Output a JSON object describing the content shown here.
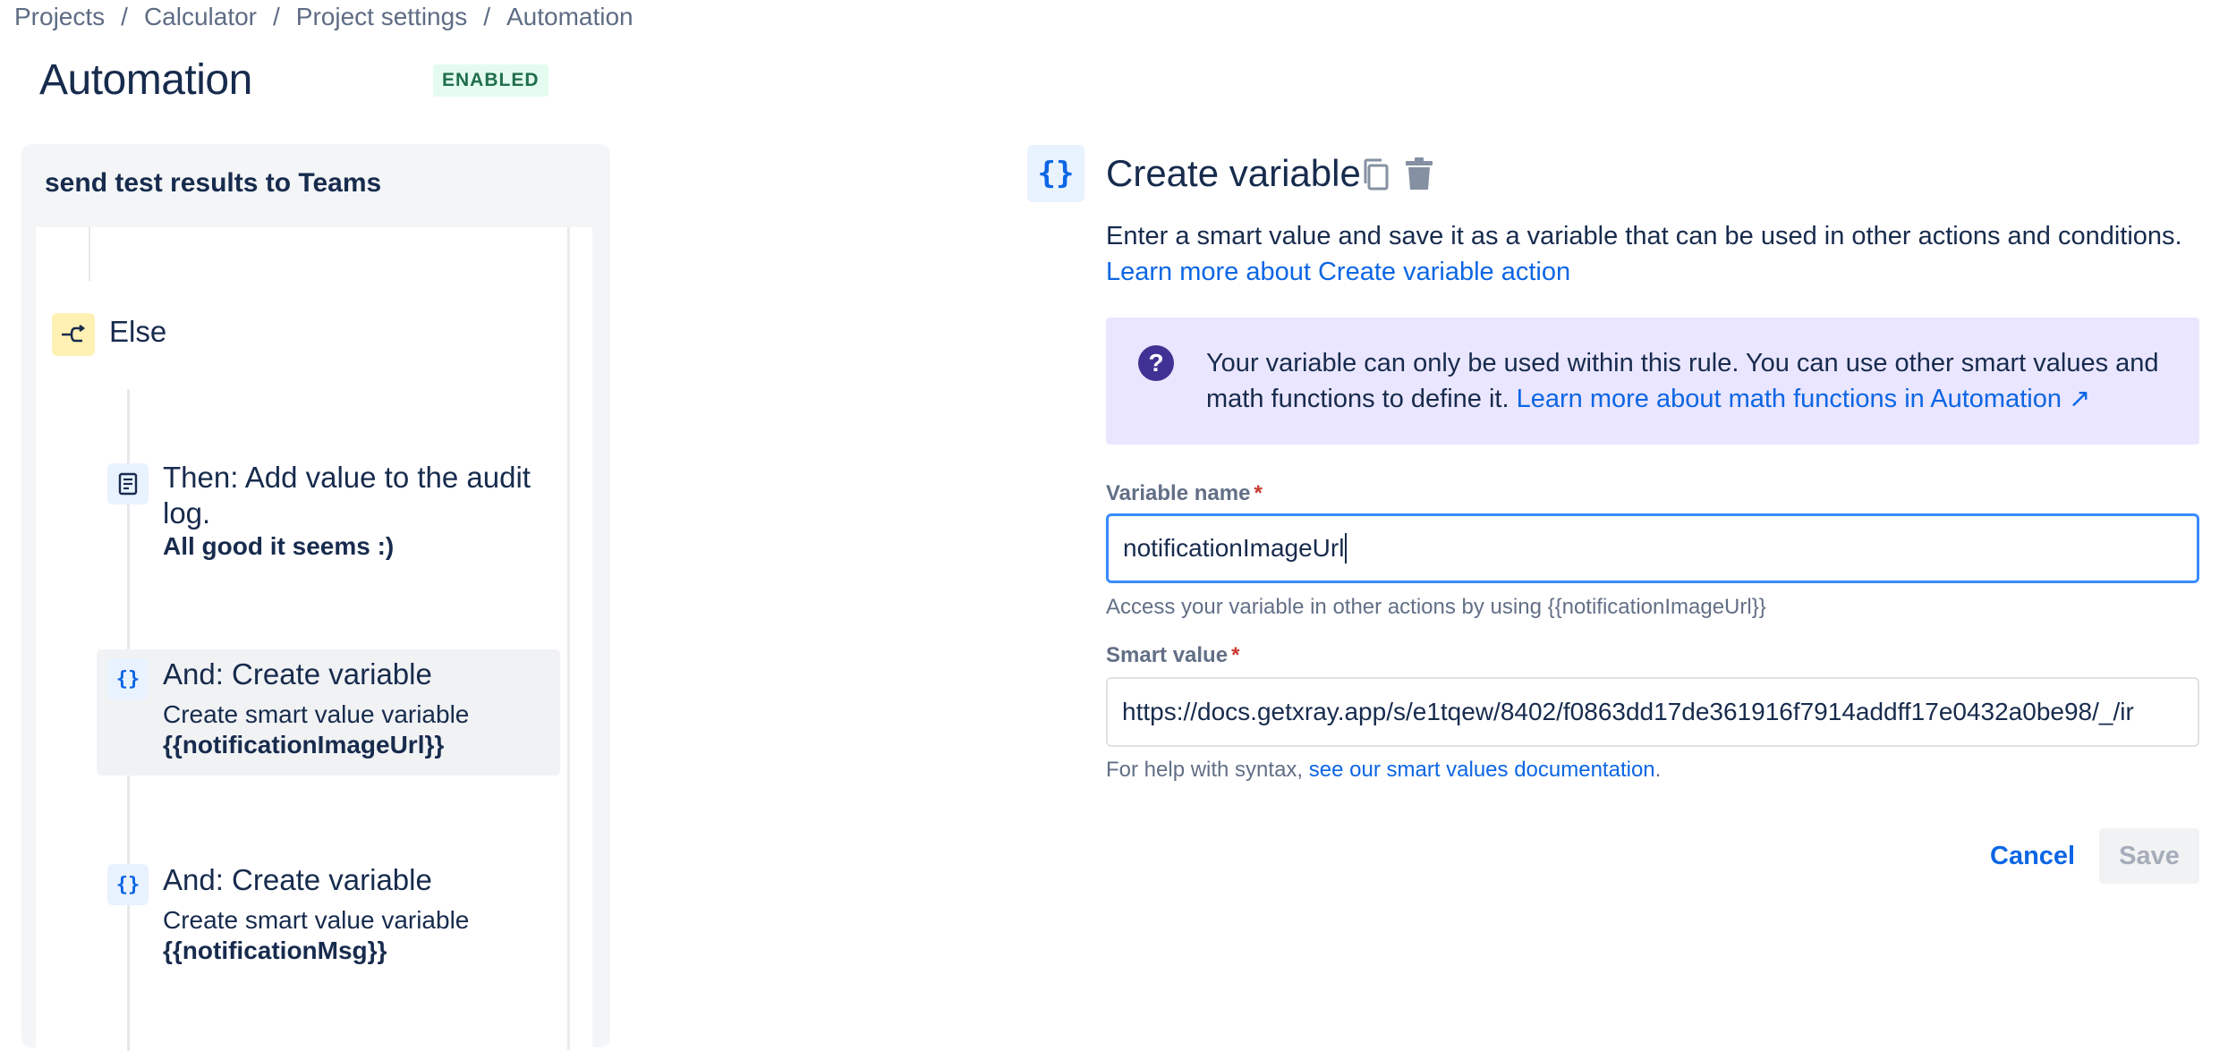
{
  "breadcrumb": [
    "Projects",
    "Calculator",
    "Project settings",
    "Automation"
  ],
  "breadcrumb_separator": "/",
  "page": {
    "title": "Automation",
    "status_badge": "ENABLED"
  },
  "rule": {
    "name": "send test results to Teams",
    "else_label": "Else",
    "components": [
      {
        "icon": "audit-log-icon",
        "title": "Then: Add value to the audit log.",
        "detail": "All good it seems :)"
      },
      {
        "icon": "braces-icon",
        "glyph": "{}",
        "title": "And: Create variable",
        "subtitle": "Create smart value variable",
        "detail": "{{notificationImageUrl}}"
      },
      {
        "icon": "braces-icon",
        "glyph": "{}",
        "title": "And: Create variable",
        "subtitle": "Create smart value variable",
        "detail": "{{notificationMsg}}"
      }
    ]
  },
  "config": {
    "icon_glyph": "{}",
    "title": "Create variable",
    "description": "Enter a smart value and save it as a variable that can be used in other actions and conditions.",
    "learn_more_link": "Learn more about Create variable action",
    "info": {
      "text": "Your variable can only be used within this rule. You can use other smart values and math functions to define it.",
      "link": "Learn more about math functions in Automation ↗",
      "icon_glyph": "?"
    },
    "variable_name": {
      "label": "Variable name",
      "required_mark": "*",
      "value": "notificationImageUrl",
      "helper": "Access your variable in other actions by using {{notificationImageUrl}}"
    },
    "smart_value": {
      "label": "Smart value",
      "required_mark": "*",
      "value": "https://docs.getxray.app/s/e1tqew/8402/f0863dd17de361916f7914addff17e0432a0be98/_/ir",
      "helper_prefix": "For help with syntax,",
      "helper_link": "see our smart values documentation",
      "helper_suffix": "."
    },
    "buttons": {
      "cancel": "Cancel",
      "save": "Save"
    }
  },
  "colors": {
    "link": "#0c66e4",
    "text": "#172b4d",
    "badge_bg": "#e3fcef",
    "badge_text": "#216e4e",
    "info_bg": "#eae6ff",
    "focus_border": "#388bff",
    "required": "#c9372c"
  }
}
